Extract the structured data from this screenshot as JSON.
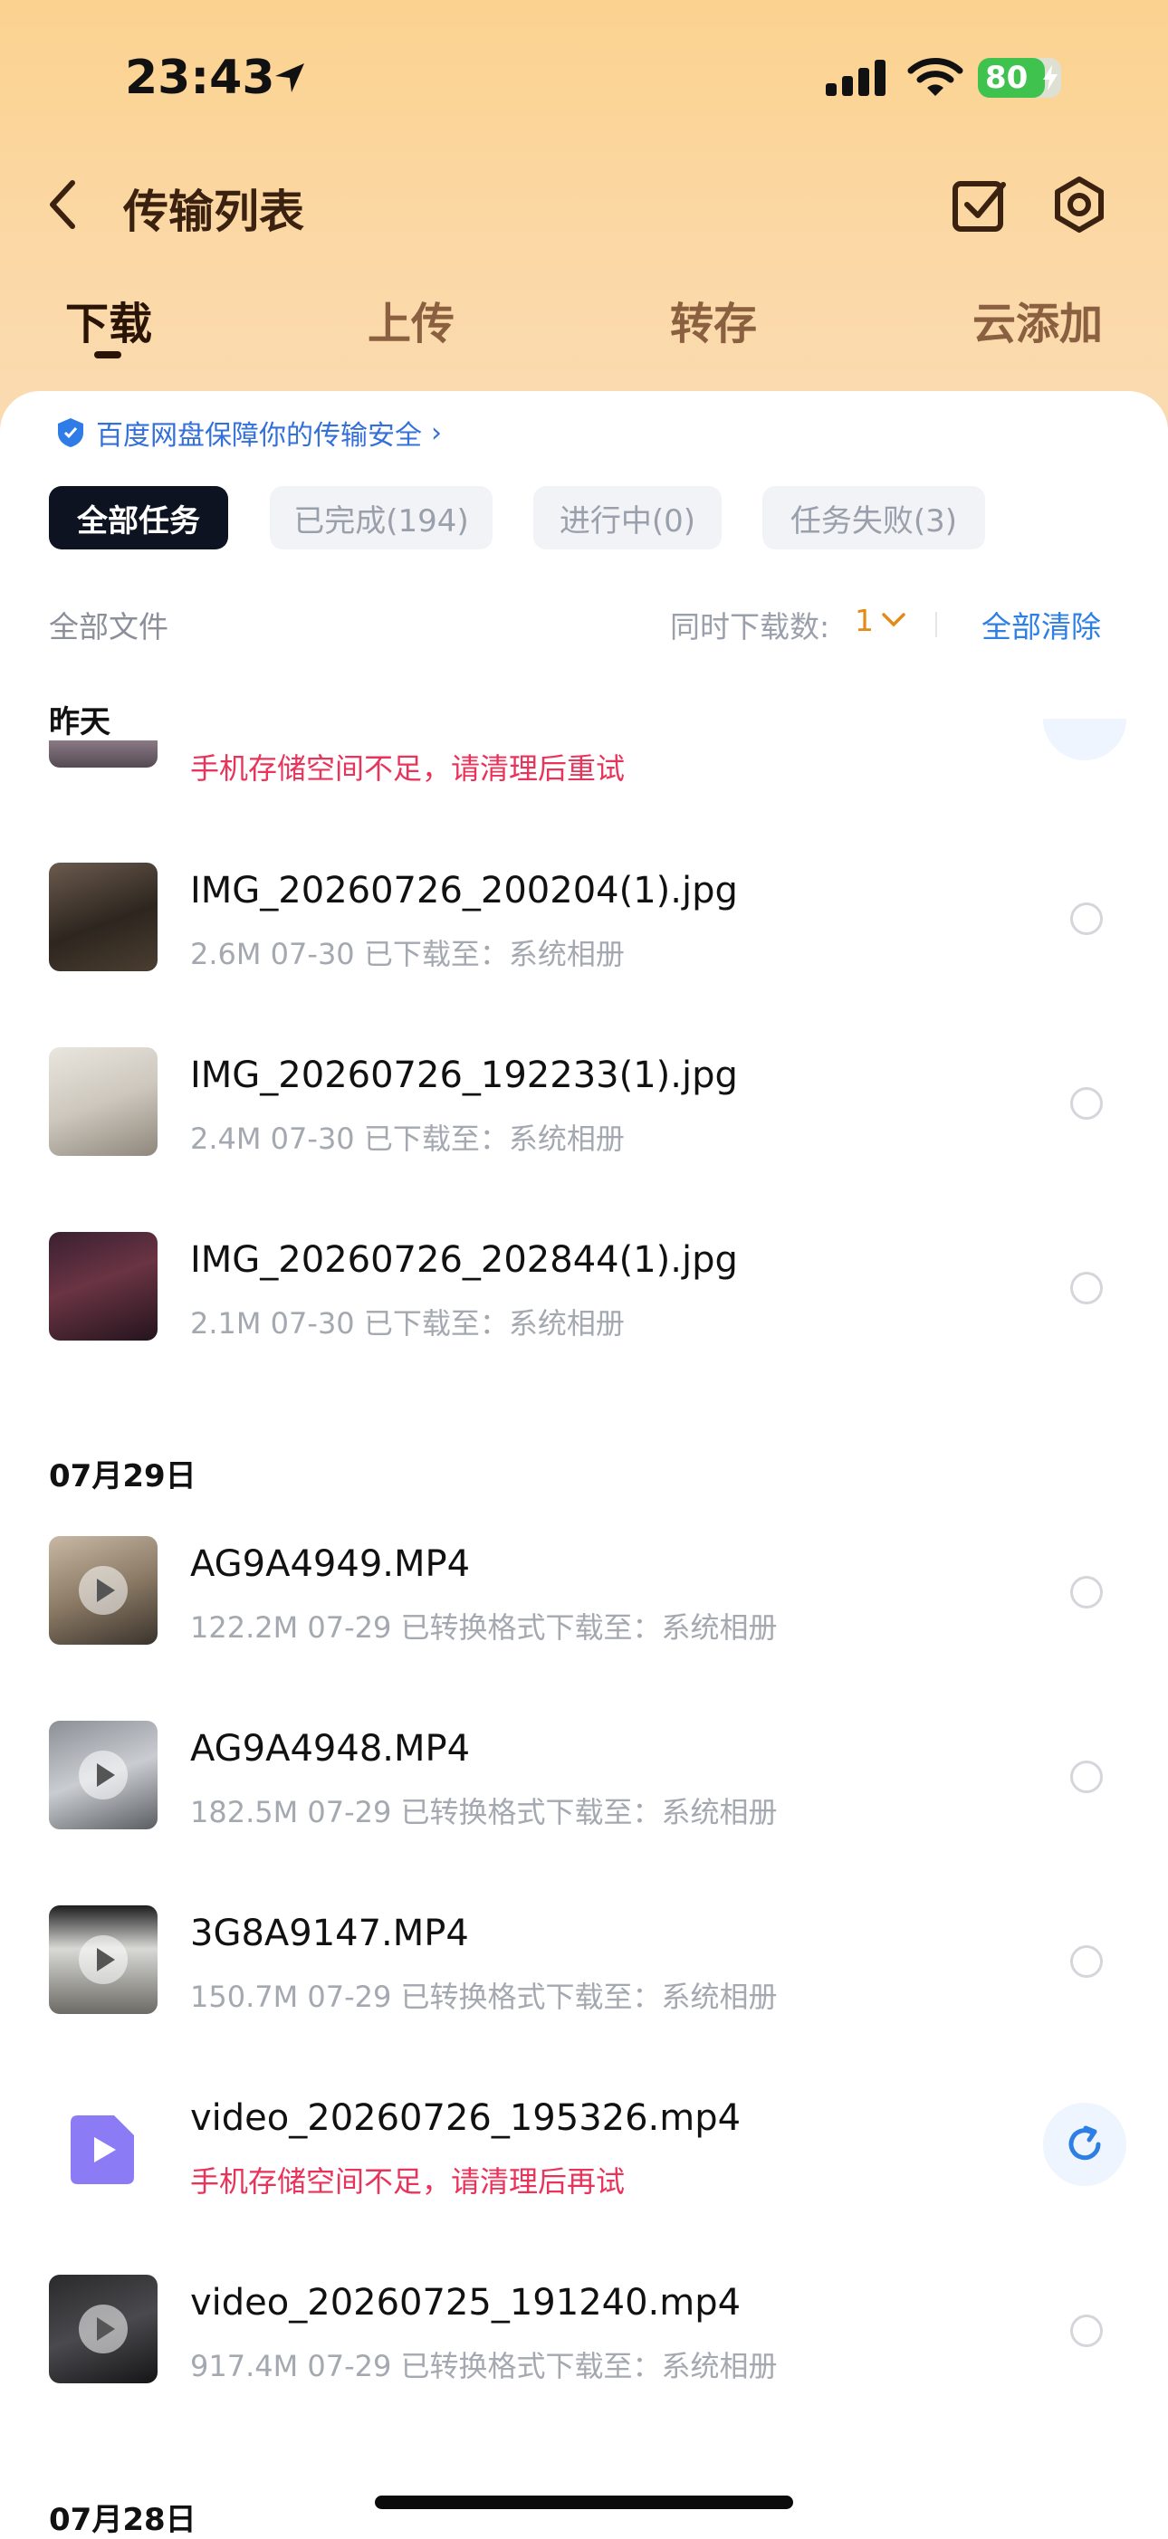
{
  "status_bar": {
    "time": "23:43",
    "battery": "80",
    "battery_level": 0.8
  },
  "header": {
    "title": "传输列表"
  },
  "tabs": [
    {
      "label": "下载",
      "active": true
    },
    {
      "label": "上传"
    },
    {
      "label": "转存"
    },
    {
      "label": "云添加"
    }
  ],
  "secure_notice": "百度网盘保障你的传输安全",
  "filters": [
    {
      "label": "全部任务",
      "active": true
    },
    {
      "label": "已完成(194)"
    },
    {
      "label": "进行中(0)"
    },
    {
      "label": "任务失败(3)"
    }
  ],
  "toolbar": {
    "files_label": "全部文件",
    "concurrent_label": "同时下载数:",
    "concurrent_value": "1",
    "clear_all": "全部清除"
  },
  "sections": {
    "yesterday": {
      "label": "昨天",
      "partial_error": "手机存储空间不足，请清理后重试",
      "items": [
        {
          "name": "IMG_20260726_200204(1).jpg",
          "meta": "2.6M  07-30  已下载至：系统相册"
        },
        {
          "name": "IMG_20260726_192233(1).jpg",
          "meta": "2.4M  07-30  已下载至：系统相册"
        },
        {
          "name": "IMG_20260726_202844(1).jpg",
          "meta": "2.1M  07-30  已下载至：系统相册"
        }
      ]
    },
    "jul29": {
      "label": "07月29日",
      "items": [
        {
          "name": "AG9A4949.MP4",
          "meta": "122.2M  07-29  已转换格式下载至：系统相册"
        },
        {
          "name": "AG9A4948.MP4",
          "meta": "182.5M  07-29  已转换格式下载至：系统相册"
        },
        {
          "name": "3G8A9147.MP4",
          "meta": "150.7M  07-29  已转换格式下载至：系统相册"
        },
        {
          "name": "video_20260726_195326.mp4",
          "meta": "手机存储空间不足，请清理后再试",
          "error": true
        },
        {
          "name": "video_20260725_191240.mp4",
          "meta": "917.4M  07-29  已转换格式下载至：系统相册"
        }
      ]
    },
    "jul28": {
      "label": "07月28日"
    }
  }
}
